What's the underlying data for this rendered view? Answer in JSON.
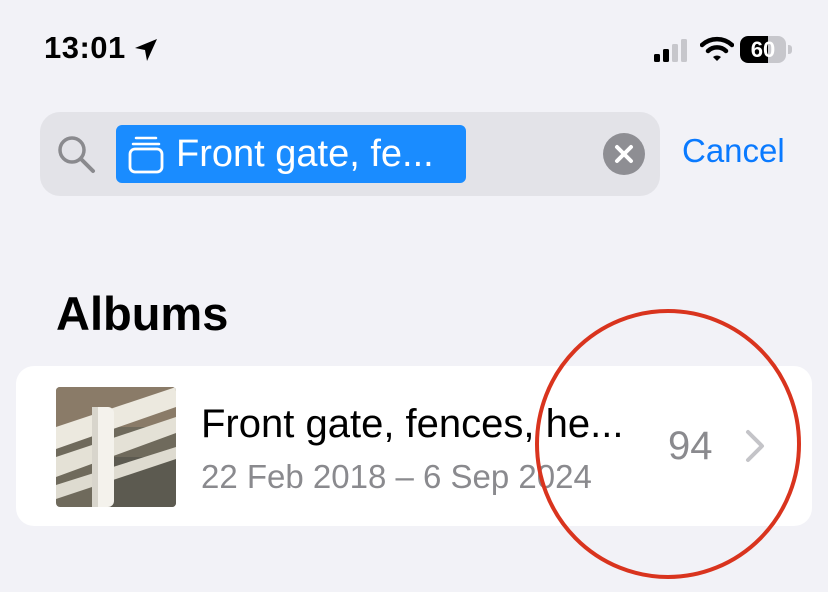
{
  "status_bar": {
    "time": "13:01",
    "location_icon": "location-arrow-icon",
    "signal_icon": "cellular-signal-icon",
    "wifi_icon": "wifi-icon",
    "battery_percent": 60,
    "battery_label": "60"
  },
  "search": {
    "icon": "search-icon",
    "token_icon": "album-stack-icon",
    "token_text": "Front gate, fe...",
    "clear_icon": "clear-icon",
    "cancel_label": "Cancel"
  },
  "albums": {
    "section_title": "Albums",
    "items": [
      {
        "name": "Front gate, fences, he...",
        "dates": "22 Feb 2018 – 6 Sep 2024",
        "count": "94",
        "chevron_icon": "chevron-right-icon"
      }
    ]
  },
  "colors": {
    "accent": "#0a7aff",
    "token_background": "#1a8cff",
    "annotation": "#d9341e",
    "page_background": "#f2f2f7"
  }
}
